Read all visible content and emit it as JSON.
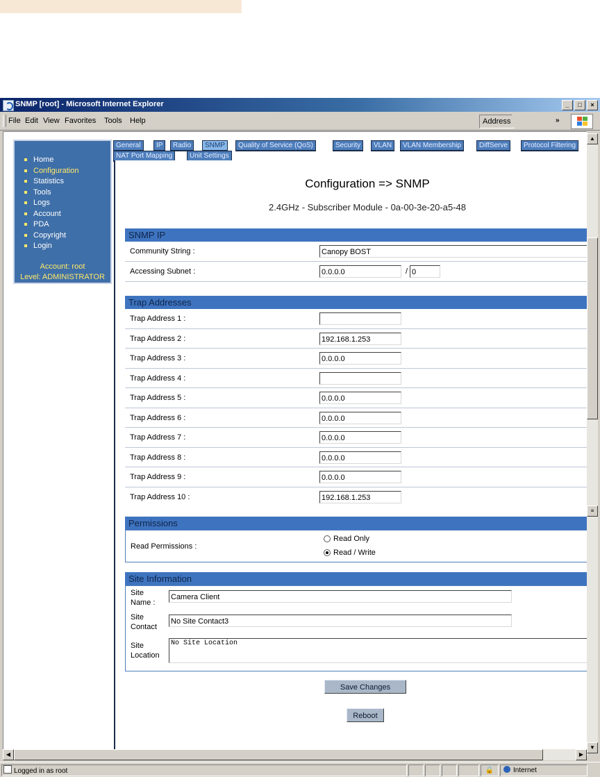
{
  "window": {
    "title": "SNMP [root] - Microsoft Internet Explorer",
    "controls": {
      "minimize": "_",
      "maximize": "□",
      "close": "×"
    }
  },
  "menu": {
    "items": [
      {
        "label": "File"
      },
      {
        "label": "Edit"
      },
      {
        "label": "View"
      },
      {
        "label": "Favorites"
      },
      {
        "label": "Tools"
      },
      {
        "label": "Help"
      }
    ],
    "address_label": "Address",
    "more": "»"
  },
  "nav": {
    "items": [
      {
        "label": "Home",
        "active": false
      },
      {
        "label": "Configuration",
        "active": true
      },
      {
        "label": "Statistics",
        "active": false
      },
      {
        "label": "Tools",
        "active": false
      },
      {
        "label": "Logs",
        "active": false
      },
      {
        "label": "Account",
        "active": false
      },
      {
        "label": "PDA",
        "active": false
      },
      {
        "label": "Copyright",
        "active": false
      },
      {
        "label": "Login",
        "active": false
      }
    ],
    "account": "Account: root",
    "level": "Level: ADMINISTRATOR"
  },
  "tabs": {
    "row1": [
      "General",
      "IP",
      "Radio",
      "SNMP",
      "Quality of Service (QoS)",
      "Security",
      "VLAN",
      "VLAN Membership",
      "DiffServe",
      "Protocol Filtering"
    ],
    "row2": [
      "NAT Port Mapping",
      "Unit Settings"
    ],
    "active": "SNMP"
  },
  "page": {
    "title": "Configuration => SNMP",
    "subtitle": "2.4GHz - Subscriber Module - 0a-00-3e-20-a5-48"
  },
  "snmp_ip": {
    "header": "SNMP IP",
    "community_label": "Community String :",
    "community_value": "Canopy BOST",
    "subnet_label": "Accessing Subnet :",
    "subnet_value": "0.0.0.0",
    "subnet_sep": "/",
    "subnet_mask": "0"
  },
  "traps": {
    "header": "Trap Addresses",
    "rows": [
      {
        "label": "Trap Address 1 :",
        "value": ""
      },
      {
        "label": "Trap Address 2 :",
        "value": "192.168.1.253"
      },
      {
        "label": "Trap Address 3 :",
        "value": "0.0.0.0"
      },
      {
        "label": "Trap Address 4 :",
        "value": ""
      },
      {
        "label": "Trap Address 5 :",
        "value": "0.0.0.0"
      },
      {
        "label": "Trap Address 6 :",
        "value": "0.0.0.0"
      },
      {
        "label": "Trap Address 7 :",
        "value": "0.0.0.0"
      },
      {
        "label": "Trap Address 8 :",
        "value": "0.0.0.0"
      },
      {
        "label": "Trap Address 9 :",
        "value": "0.0.0.0"
      },
      {
        "label": "Trap Address 10 :",
        "value": "192.168.1.253"
      }
    ]
  },
  "permissions": {
    "header": "Permissions",
    "label": "Read Permissions :",
    "options": [
      {
        "label": "Read Only",
        "selected": false
      },
      {
        "label": "Read / Write",
        "selected": true
      }
    ]
  },
  "site": {
    "header": "Site Information",
    "name_label": [
      "Site",
      "Name :"
    ],
    "name_value": "Camera Client",
    "contact_label": [
      "Site",
      "Contact"
    ],
    "contact_value": "No Site Contact3",
    "location_label": [
      "Site",
      "Location"
    ],
    "location_value": "No Site Location"
  },
  "buttons": {
    "save": "Save Changes",
    "reboot": "Reboot"
  },
  "status": {
    "text": "Logged in as root",
    "zone": "Internet"
  }
}
